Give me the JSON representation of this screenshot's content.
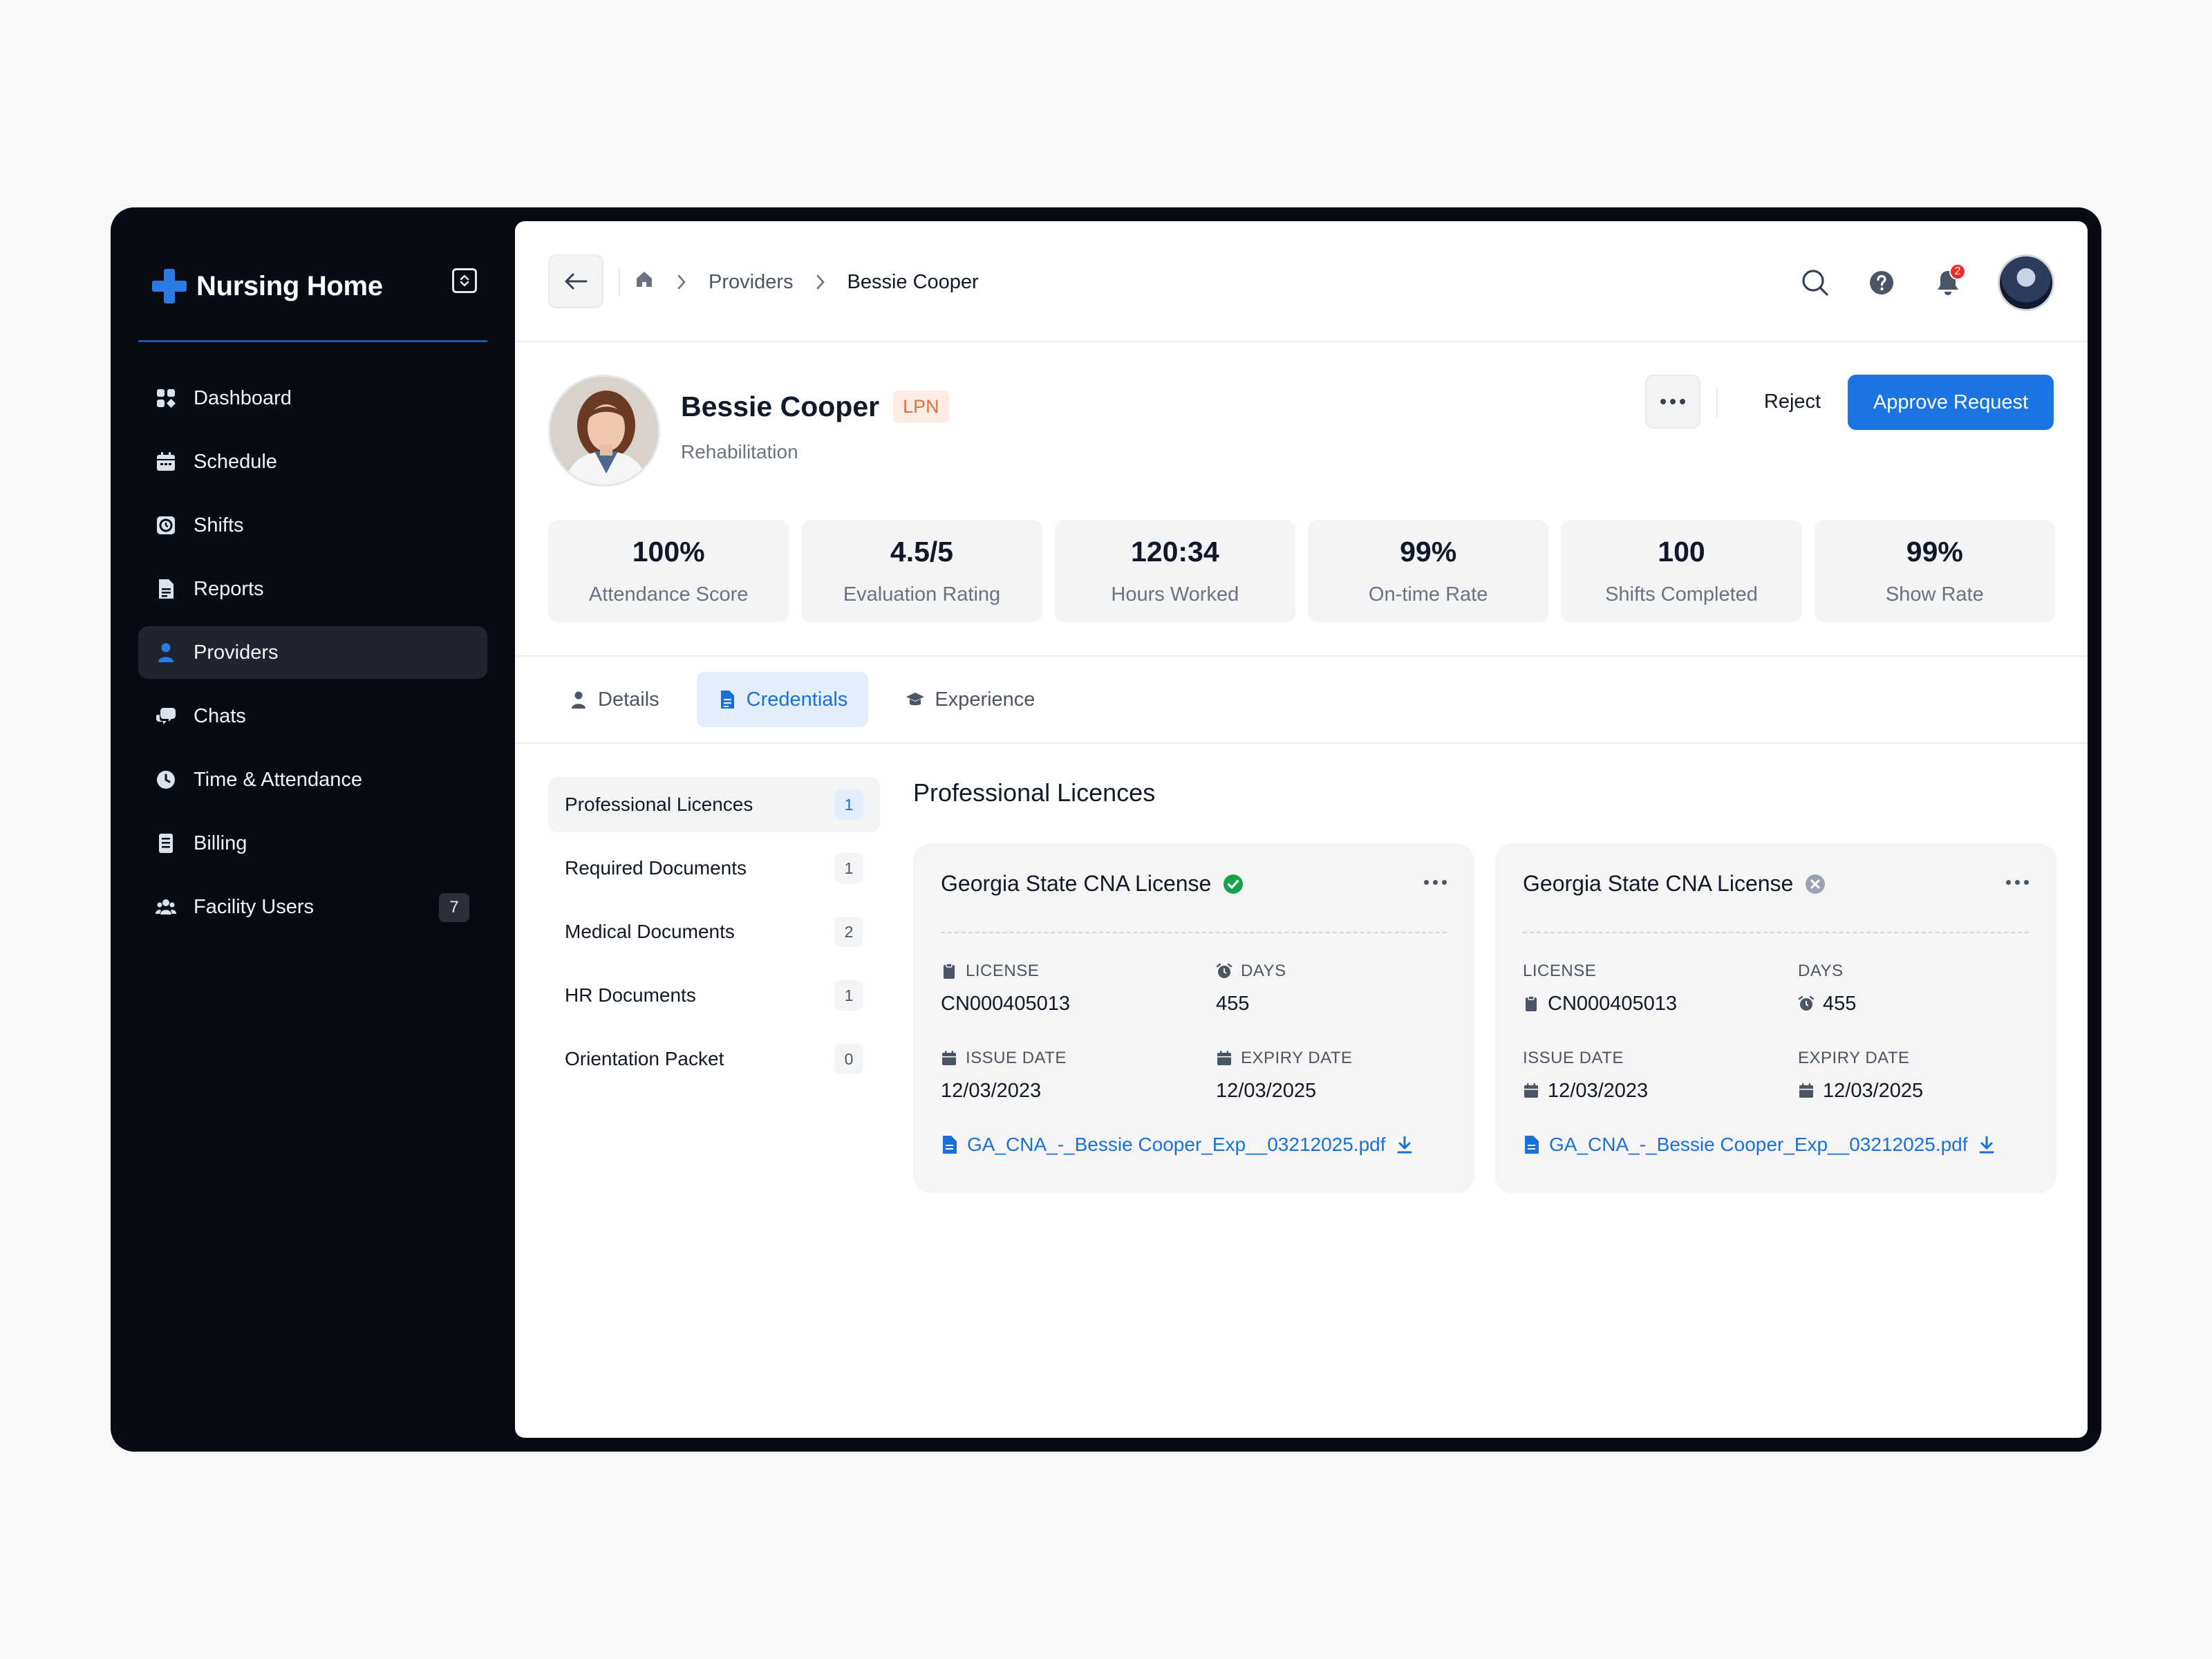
{
  "brand": {
    "name": "Nursing Home",
    "accent": "#2b7be4"
  },
  "sidebar": {
    "items": [
      {
        "label": "Dashboard",
        "icon": "dashboard-icon"
      },
      {
        "label": "Schedule",
        "icon": "calendar-icon"
      },
      {
        "label": "Shifts",
        "icon": "shifts-icon"
      },
      {
        "label": "Reports",
        "icon": "report-icon"
      },
      {
        "label": "Providers",
        "icon": "user-icon",
        "active": true
      },
      {
        "label": "Chats",
        "icon": "chat-icon"
      },
      {
        "label": "Time & Attendance",
        "icon": "clock-icon"
      },
      {
        "label": "Billing",
        "icon": "billing-icon"
      },
      {
        "label": "Facility Users",
        "icon": "users-icon",
        "badge": "7"
      }
    ]
  },
  "topbar": {
    "breadcrumb": [
      "Providers",
      "Bessie Cooper"
    ],
    "notifications_count": "2"
  },
  "profile": {
    "name": "Bessie Cooper",
    "badge": "LPN",
    "department": "Rehabilitation",
    "actions": {
      "reject_label": "Reject",
      "approve_label": "Approve Request"
    }
  },
  "stats": [
    {
      "value": "100%",
      "label": "Attendance Score"
    },
    {
      "value": "4.5/5",
      "label": "Evaluation Rating"
    },
    {
      "value": "120:34",
      "label": "Hours Worked"
    },
    {
      "value": "99%",
      "label": "On-time Rate"
    },
    {
      "value": "100",
      "label": "Shifts Completed"
    },
    {
      "value": "99%",
      "label": "Show Rate"
    }
  ],
  "tabs": [
    {
      "label": "Details",
      "icon": "person-icon"
    },
    {
      "label": "Credentials",
      "icon": "document-icon",
      "active": true
    },
    {
      "label": "Experience",
      "icon": "graduation-cap-icon"
    }
  ],
  "doc_nav": [
    {
      "label": "Professional Licences",
      "count": "1",
      "active": true
    },
    {
      "label": "Required Documents",
      "count": "1"
    },
    {
      "label": "Medical Documents",
      "count": "2"
    },
    {
      "label": "HR Documents",
      "count": "1"
    },
    {
      "label": "Orientation Packet",
      "count": "0"
    }
  ],
  "section_title": "Professional Licences",
  "cards": [
    {
      "title": "Georgia State CNA License",
      "status": "verified",
      "status_color": "#16a34a",
      "license_label": "LICENSE",
      "license_value": "CN000405013",
      "days_label": "DAYS",
      "days_value": "455",
      "issue_label": "ISSUE DATE",
      "issue_value": "12/03/2023",
      "expiry_label": "EXPIRY DATE",
      "expiry_value": "12/03/2025",
      "file_name": "GA_CNA_-_Bessie Cooper_Exp__03212025.pdf"
    },
    {
      "title": "Georgia State CNA License",
      "status": "unverified",
      "status_color": "#9ca3af",
      "license_label": "LICENSE",
      "license_value": "CN000405013",
      "days_label": "DAYS",
      "days_value": "455",
      "issue_label": "ISSUE DATE",
      "issue_value": "12/03/2023",
      "expiry_label": "EXPIRY DATE",
      "expiry_value": "12/03/2025",
      "file_name": "GA_CNA_-_Bessie Cooper_Exp__03212025.pdf"
    }
  ]
}
